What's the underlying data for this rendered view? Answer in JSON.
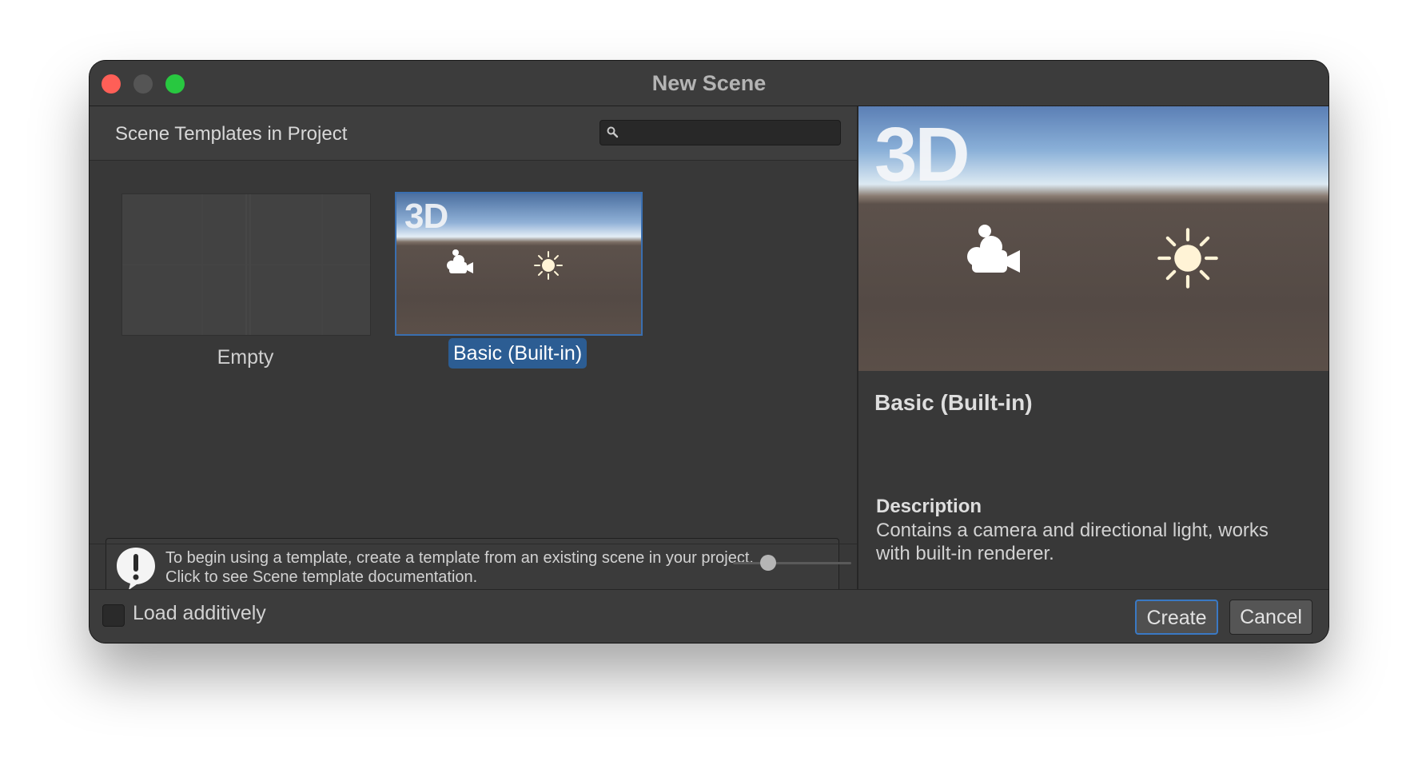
{
  "window": {
    "title": "New Scene"
  },
  "left_pane": {
    "header_title": "Scene Templates in Project",
    "search": {
      "value": "",
      "placeholder": ""
    },
    "templates": [
      {
        "label": "Empty",
        "selected": false
      },
      {
        "label": "Basic (Built-in)",
        "selected": true,
        "thumbnail_text": "3D"
      }
    ],
    "info": {
      "line1": "To begin using a template, create a template from an existing scene in your project.",
      "line2": "Click to see Scene template documentation."
    },
    "zoom_slider": {
      "value": 0.3
    }
  },
  "right_pane": {
    "preview_text": "3D",
    "template_name": "Basic (Built-in)",
    "description_label": "Description",
    "description_text": "Contains a camera and directional light, works with built-in renderer."
  },
  "footer": {
    "load_additively_label": "Load additively",
    "load_additively_checked": false,
    "create_label": "Create",
    "cancel_label": "Cancel"
  },
  "colors": {
    "window_bg": "#383838",
    "selection": "#2c5d93",
    "accent_border": "#3a79c4",
    "close": "#fe5f57",
    "minimize": "#555555",
    "maximize": "#28c840"
  }
}
